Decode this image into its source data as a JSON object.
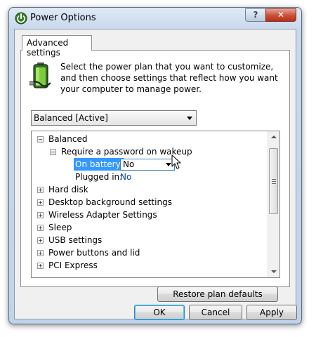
{
  "window": {
    "title": "Power Options",
    "help_label": "?",
    "close_label": "✕"
  },
  "tab": {
    "label": "Advanced settings"
  },
  "description": "Select the power plan that you want to customize, and then choose settings that reflect how you want your computer to manage power.",
  "plan_select": {
    "value": "Balanced [Active]"
  },
  "tree": {
    "root": {
      "label": "Balanced",
      "expander": "−"
    },
    "password": {
      "label": "Require a password on wakeup",
      "expander": "−"
    },
    "on_battery": {
      "label": "On battery:",
      "value": "No"
    },
    "plugged_in": {
      "label": "Plugged in:",
      "value": "No"
    },
    "categories": [
      {
        "label": "Hard disk",
        "expander": "+"
      },
      {
        "label": "Desktop background settings",
        "expander": "+"
      },
      {
        "label": "Wireless Adapter Settings",
        "expander": "+"
      },
      {
        "label": "Sleep",
        "expander": "+"
      },
      {
        "label": "USB settings",
        "expander": "+"
      },
      {
        "label": "Power buttons and lid",
        "expander": "+"
      },
      {
        "label": "PCI Express",
        "expander": "+"
      }
    ]
  },
  "buttons": {
    "restore": "Restore plan defaults",
    "ok": "OK",
    "cancel": "Cancel",
    "apply": "Apply"
  },
  "icons": {
    "title": "power-options-icon",
    "battery": "battery-icon",
    "cursor": "mouse-pointer-icon"
  },
  "colors": {
    "selection": "#3399ff",
    "link": "#0645ad",
    "titlebar": "#c9d9ec",
    "close_button": "#c74e37"
  }
}
